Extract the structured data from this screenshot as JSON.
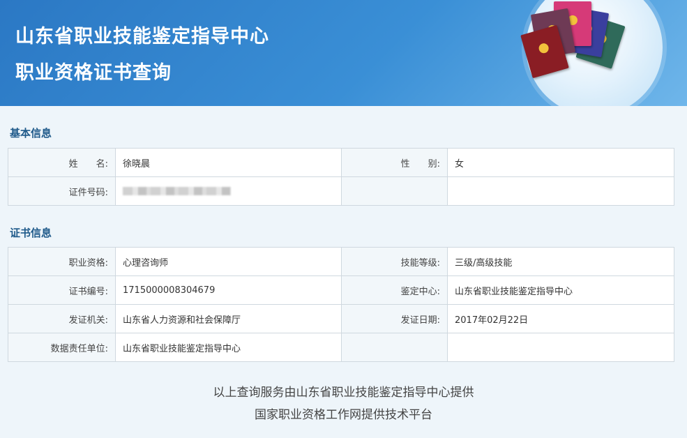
{
  "header": {
    "title_line1": "山东省职业技能鉴定指导中心",
    "title_line2": "职业资格证书查询",
    "banner_image": "certificate-books-illustration"
  },
  "basic_info": {
    "section_title": "基本信息",
    "name_label": "姓　　名:",
    "name_value": "徐晓晨",
    "gender_label": "性　　别:",
    "gender_value": "女",
    "id_label": "证件号码:",
    "id_value_redacted": true
  },
  "cert_info": {
    "section_title": "证书信息",
    "rows": [
      {
        "l1": "职业资格:",
        "v1": "心理咨询师",
        "l2": "技能等级:",
        "v2": "三级/高级技能"
      },
      {
        "l1": "证书编号:",
        "v1": "1715000008304679",
        "l2": "鉴定中心:",
        "v2": "山东省职业技能鉴定指导中心"
      },
      {
        "l1": "发证机关:",
        "v1": "山东省人力资源和社会保障厅",
        "l2": "发证日期:",
        "v2": "2017年02月22日"
      },
      {
        "l1": "数据责任单位:",
        "v1": "山东省职业技能鉴定指导中心",
        "l2": "",
        "v2": ""
      }
    ]
  },
  "footer": {
    "line1": "以上查询服务由山东省职业技能鉴定指导中心提供",
    "line2": "国家职业资格工作网提供技术平台"
  },
  "colors": {
    "header_blue": "#2b78c4",
    "section_title": "#1f5a8a",
    "page_bg": "#eef5fa"
  }
}
